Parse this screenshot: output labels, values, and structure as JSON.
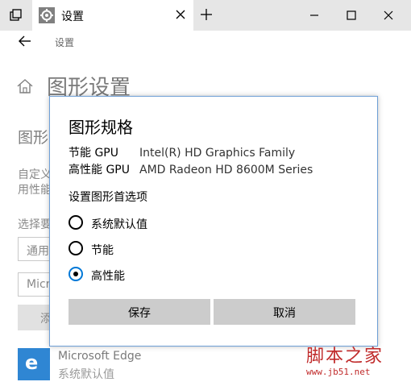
{
  "window": {
    "tab_title": "设置"
  },
  "nav": {
    "breadcrumb": "设置"
  },
  "page": {
    "title": "图形设置",
    "section_heading": "图形",
    "description_line1": "自定义",
    "description_line2": "用性能",
    "choose_label": "选择要",
    "select_value": "通用",
    "input_value": "Micr",
    "add_button": "添"
  },
  "app_entry": {
    "name": "Microsoft Edge",
    "preference": "系统默认值",
    "icon": "edge-icon"
  },
  "dialog": {
    "title": "图形规格",
    "power_saving_label": "节能 GPU",
    "power_saving_value": "Intel(R) HD Graphics Family",
    "high_perf_label": "高性能 GPU",
    "high_perf_value": "AMD Radeon HD 8600M Series",
    "preference_heading": "设置图形首选项",
    "options": [
      {
        "label": "系统默认值",
        "selected": false
      },
      {
        "label": "节能",
        "selected": false
      },
      {
        "label": "高性能",
        "selected": true
      }
    ],
    "save_button": "保存",
    "cancel_button": "取消"
  },
  "watermark": {
    "text": "脚本之家",
    "url": "www.jb51.net"
  },
  "colors": {
    "accent": "#0078d7",
    "titlebar": "#e6e6e6",
    "button": "#cccccc"
  }
}
